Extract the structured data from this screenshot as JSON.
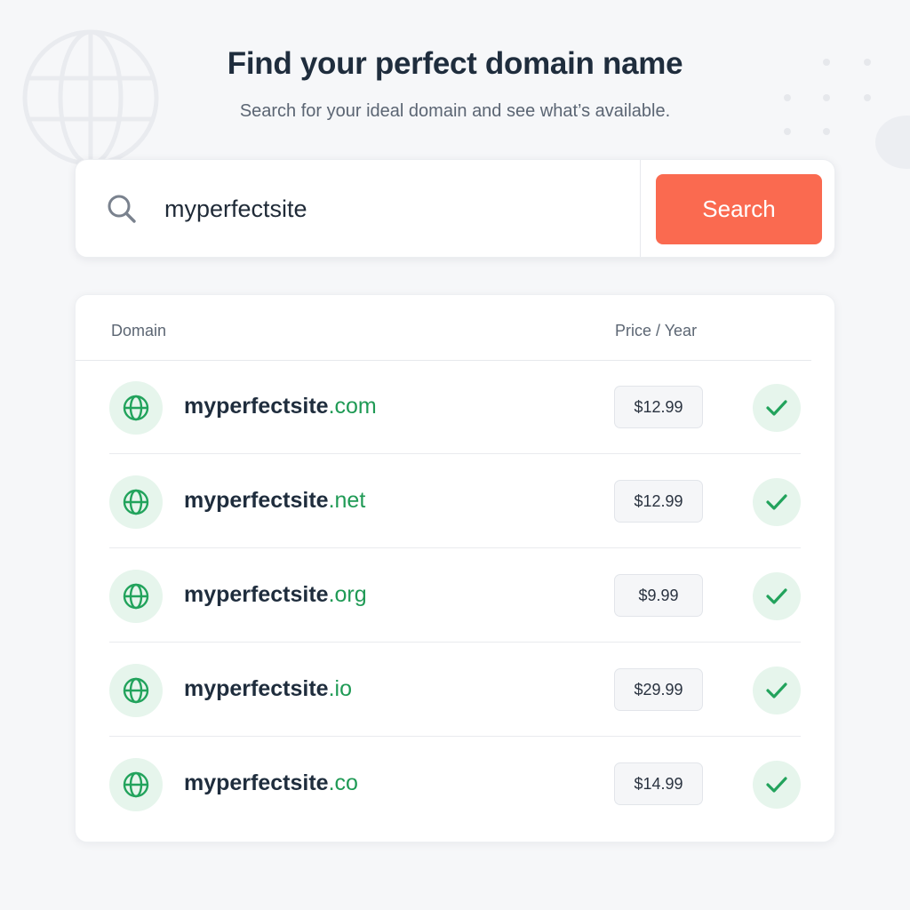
{
  "header": {
    "title": "Find your perfect domain name",
    "subtitle": "Search for your ideal domain and see what’s available."
  },
  "search": {
    "value": "myperfectsite",
    "button_label": "Search"
  },
  "table": {
    "columns": {
      "domain": "Domain",
      "price": "Price / Year"
    },
    "rows": [
      {
        "name": "myperfectsite",
        "tld": ".com",
        "price": "$12.99"
      },
      {
        "name": "myperfectsite",
        "tld": ".net",
        "price": "$12.99"
      },
      {
        "name": "myperfectsite",
        "tld": ".org",
        "price": "$9.99"
      },
      {
        "name": "myperfectsite",
        "tld": ".io",
        "price": "$29.99"
      },
      {
        "name": "myperfectsite",
        "tld": ".co",
        "price": "$14.99"
      }
    ]
  },
  "icons": {
    "search": "search-icon",
    "row_globe": "globe-icon",
    "available": "check-icon",
    "decor_globe": "globe-icon"
  },
  "colors": {
    "accent": "#fa6a50",
    "tld_green": "#1f9a55",
    "badge_green_bg": "#e6f5ec",
    "title": "#1f2d3d"
  }
}
